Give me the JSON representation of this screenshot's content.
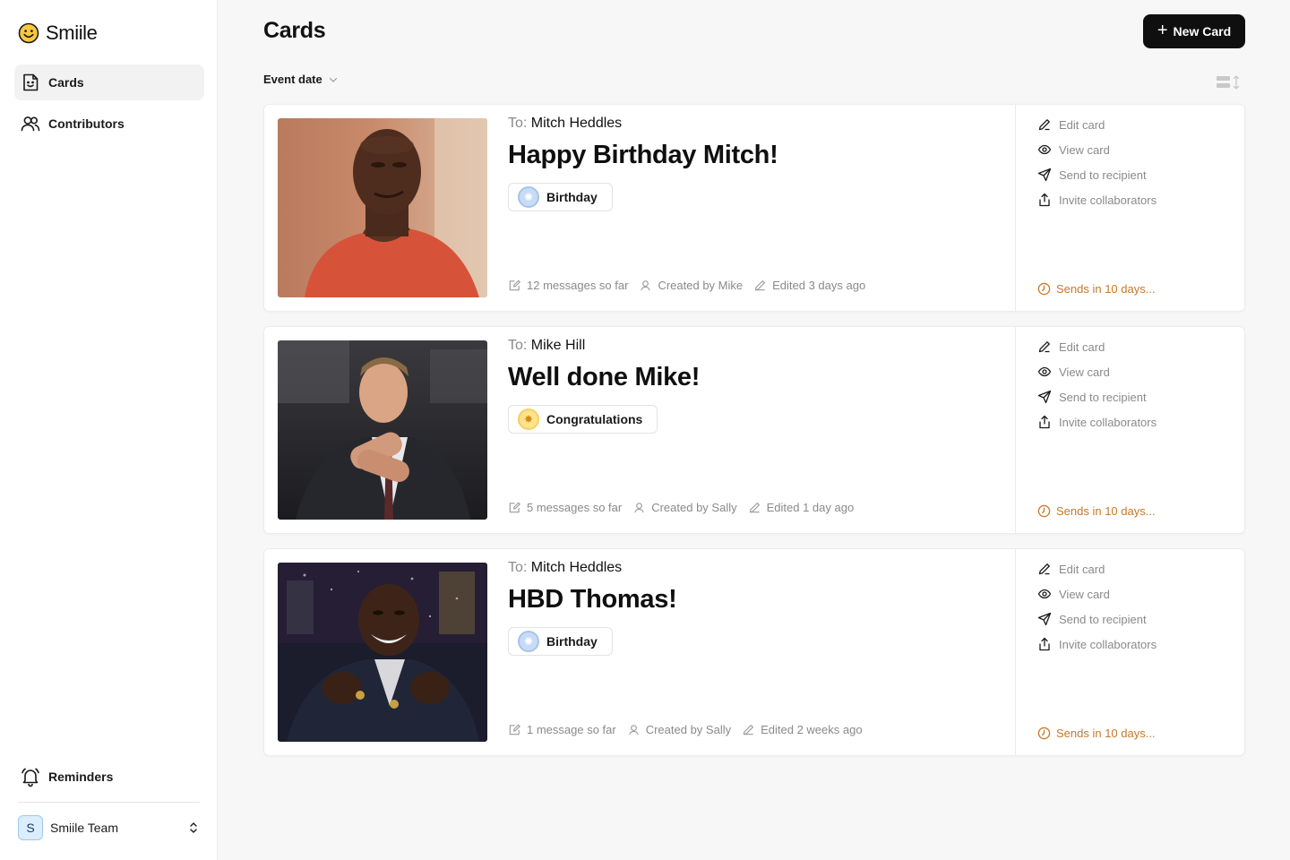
{
  "app": {
    "name": "Smiile"
  },
  "sidebar": {
    "nav": [
      {
        "label": "Cards",
        "active": true
      },
      {
        "label": "Contributors",
        "active": false
      }
    ],
    "reminders_label": "Reminders",
    "team": {
      "initial": "S",
      "name": "Smiile Team"
    }
  },
  "header": {
    "title": "Cards",
    "new_card_label": "New Card",
    "sort_label": "Event date"
  },
  "cards": [
    {
      "to_label": "To:",
      "recipient": "Mitch Heddles",
      "title": "Happy Birthday Mitch!",
      "tag": "Birthday",
      "messages": "12 messages so far",
      "created_by": "Created by Mike",
      "edited": "Edited 3 days ago",
      "sends": "Sends in 10 days..."
    },
    {
      "to_label": "To:",
      "recipient": "Mike Hill",
      "title": "Well done Mike!",
      "tag": "Congratulations",
      "messages": "5 messages so far",
      "created_by": "Created by Sally",
      "edited": "Edited 1 day ago",
      "sends": "Sends in 10 days..."
    },
    {
      "to_label": "To:",
      "recipient": "Mitch Heddles",
      "title": "HBD Thomas!",
      "tag": "Birthday",
      "messages": "1 message so far",
      "created_by": "Created by Sally",
      "edited": "Edited 2 weeks ago",
      "sends": "Sends in 10 days..."
    }
  ],
  "actions": {
    "edit": "Edit card",
    "view": "View card",
    "send": "Send to recipient",
    "invite": "Invite collaborators"
  },
  "colors": {
    "accent": "#0f0f0f",
    "sends": "#c8782a",
    "muted": "#8a8a8a"
  }
}
